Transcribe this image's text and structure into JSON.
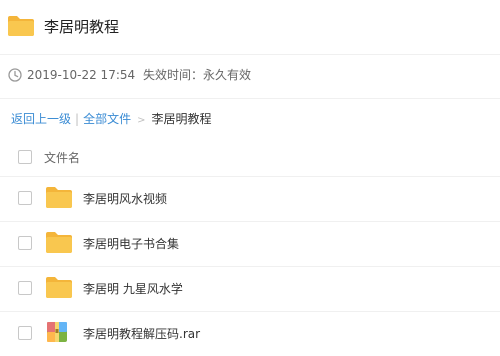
{
  "header": {
    "title": "李居明教程"
  },
  "meta": {
    "date": "2019-10-22 17:54",
    "expire": "失效时间：永久有效"
  },
  "breadcrumb": {
    "back": "返回上一级",
    "separator": "|",
    "all_files": "全部文件",
    "arrow": ">",
    "current": "李居明教程"
  },
  "list": {
    "column_name": "文件名",
    "items": [
      {
        "name": "李居明风水视频",
        "icon": "folder-icon"
      },
      {
        "name": "李居明电子书合集",
        "icon": "folder-icon"
      },
      {
        "name": "李居明 九星风水学",
        "icon": "folder-icon"
      },
      {
        "name": "李居明教程解压码.rar",
        "icon": "archive-icon"
      }
    ]
  },
  "colors": {
    "folder": "#f9c74f",
    "folder_tab": "#f4b53a",
    "link": "#3b8cd4",
    "text": "#333333",
    "muted": "#666666",
    "divider": "#f0f0f0"
  }
}
